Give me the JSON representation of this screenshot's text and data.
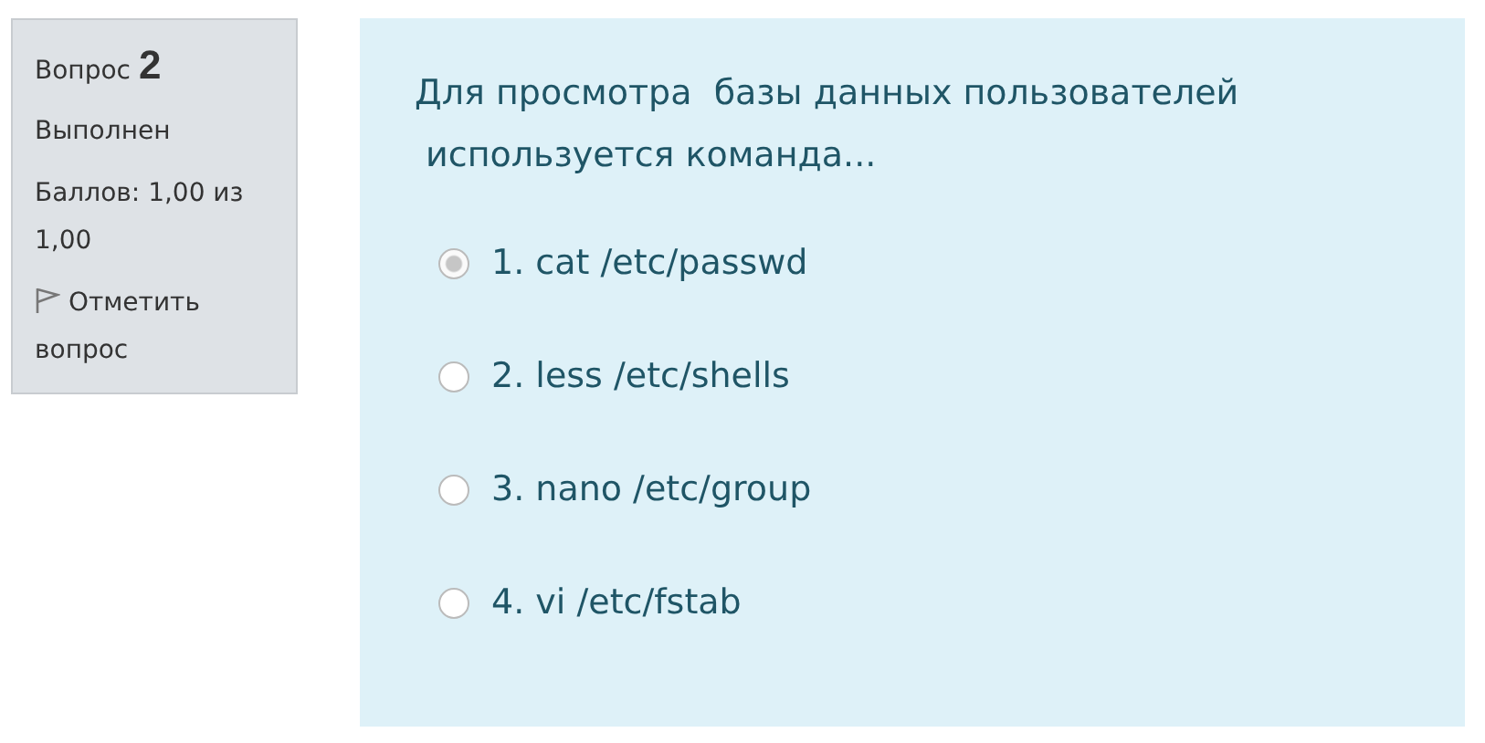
{
  "info": {
    "question_label": "Вопрос",
    "question_number": "2",
    "status": "Выполнен",
    "grade": "Баллов: 1,00 из 1,00",
    "flag_label": "Отметить вопрос"
  },
  "question": {
    "lines": [
      "Для просмотра  базы данных пользователей",
      " используется команда..."
    ],
    "options": [
      {
        "label": "1. cat /etc/passwd",
        "selected": true
      },
      {
        "label": "2. less /etc/shells",
        "selected": false
      },
      {
        "label": "3. nano /etc/group",
        "selected": false
      },
      {
        "label": "4. vi /etc/fstab",
        "selected": false
      }
    ]
  }
}
